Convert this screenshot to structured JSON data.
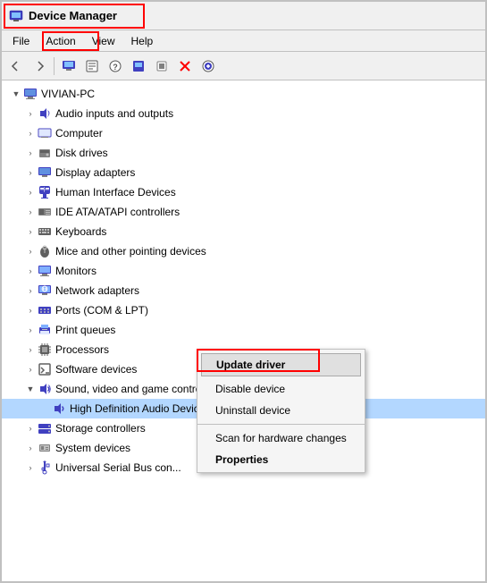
{
  "window": {
    "title": "Device Manager",
    "title_icon": "🖥",
    "menus": [
      "File",
      "Action",
      "View",
      "Help"
    ]
  },
  "toolbar": {
    "buttons": [
      "←",
      "→",
      "🖥",
      "📋",
      "❓",
      "📺",
      "💻",
      "🗑",
      "⊕"
    ]
  },
  "tree": {
    "root": "VIVIAN-PC",
    "items": [
      {
        "label": "Audio inputs and outputs",
        "icon": "🔊",
        "level": "level1",
        "expandable": true
      },
      {
        "label": "Computer",
        "icon": "💻",
        "level": "level1",
        "expandable": true
      },
      {
        "label": "Disk drives",
        "icon": "💾",
        "level": "level1",
        "expandable": true
      },
      {
        "label": "Display adapters",
        "icon": "🖥",
        "level": "level1",
        "expandable": true
      },
      {
        "label": "Human Interface Devices",
        "icon": "🎮",
        "level": "level1",
        "expandable": true
      },
      {
        "label": "IDE ATA/ATAPI controllers",
        "icon": "🔧",
        "level": "level1",
        "expandable": true
      },
      {
        "label": "Keyboards",
        "icon": "⌨",
        "level": "level1",
        "expandable": true
      },
      {
        "label": "Mice and other pointing devices",
        "icon": "🖱",
        "level": "level1",
        "expandable": true
      },
      {
        "label": "Monitors",
        "icon": "🖥",
        "level": "level1",
        "expandable": true
      },
      {
        "label": "Network adapters",
        "icon": "🌐",
        "level": "level1",
        "expandable": true
      },
      {
        "label": "Ports (COM & LPT)",
        "icon": "📡",
        "level": "level1",
        "expandable": true
      },
      {
        "label": "Print queues",
        "icon": "🖨",
        "level": "level1",
        "expandable": true
      },
      {
        "label": "Processors",
        "icon": "⚙",
        "level": "level1",
        "expandable": true
      },
      {
        "label": "Software devices",
        "icon": "📦",
        "level": "level1",
        "expandable": true
      },
      {
        "label": "Sound, video and game controllers",
        "icon": "🔊",
        "level": "level1",
        "expandable": true,
        "expanded": true
      },
      {
        "label": "High Definition Audio Device",
        "icon": "🔊",
        "level": "level2",
        "expandable": false,
        "selected": true
      },
      {
        "label": "Storage controllers",
        "icon": "💽",
        "level": "level1",
        "expandable": true
      },
      {
        "label": "System devices",
        "icon": "🔧",
        "level": "level1",
        "expandable": true
      },
      {
        "label": "Universal Serial Bus con...",
        "icon": "🔌",
        "level": "level1",
        "expandable": true
      }
    ]
  },
  "context_menu": {
    "items": [
      {
        "label": "Update driver",
        "type": "first"
      },
      {
        "label": "Disable device",
        "type": "normal"
      },
      {
        "label": "Uninstall device",
        "type": "normal"
      },
      {
        "label": "separator"
      },
      {
        "label": "Scan for hardware changes",
        "type": "normal"
      },
      {
        "label": "Properties",
        "type": "bold"
      }
    ]
  }
}
